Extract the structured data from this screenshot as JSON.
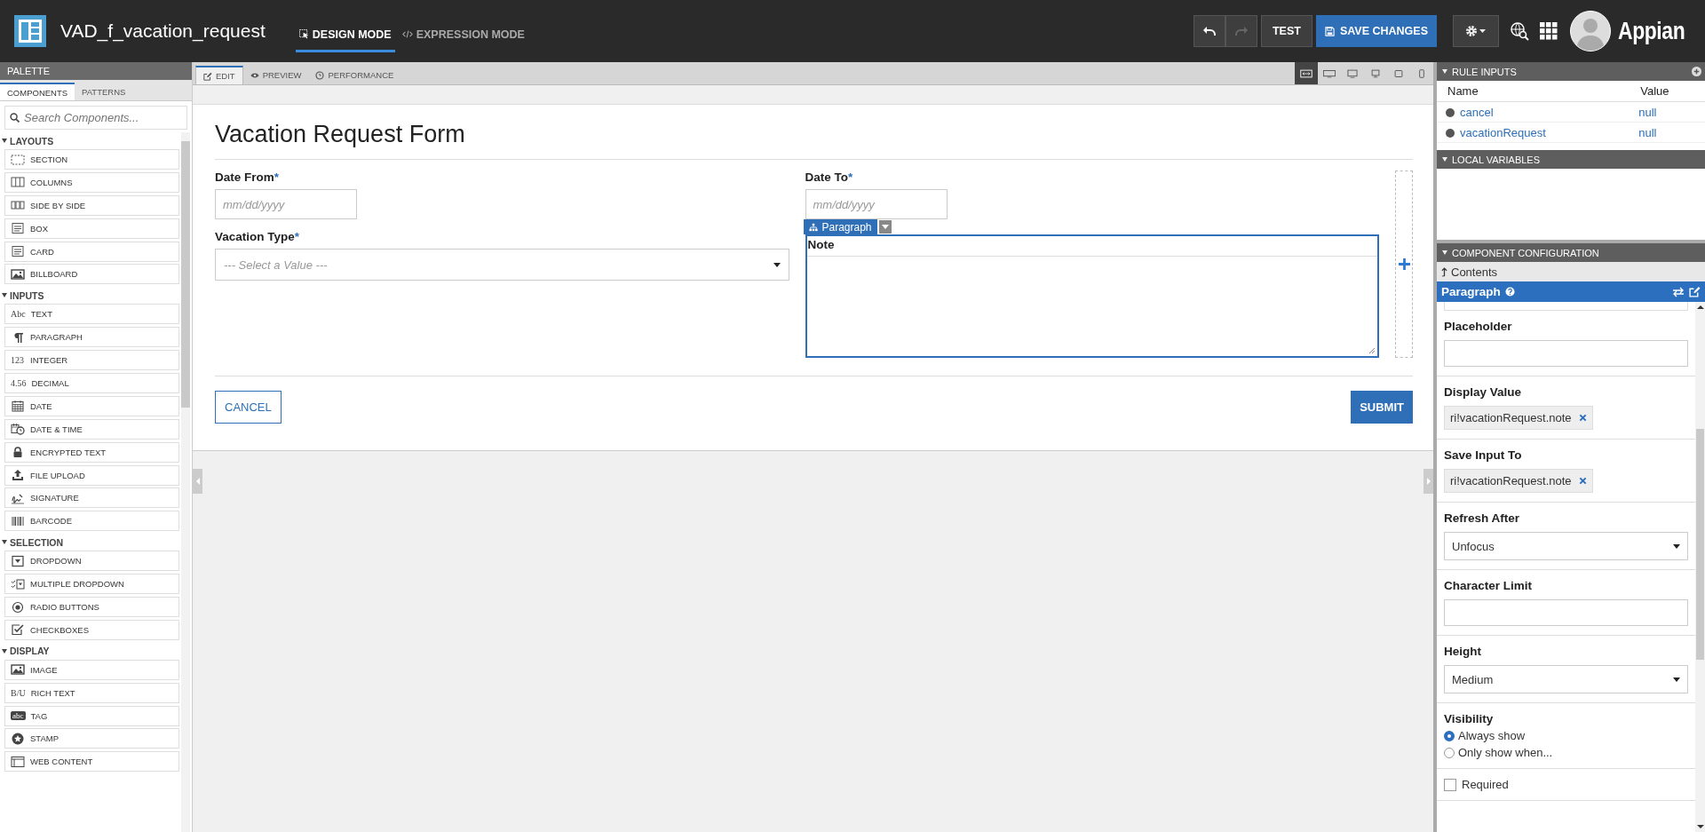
{
  "header": {
    "title": "VAD_f_vacation_request",
    "modes": [
      {
        "label": "DESIGN MODE",
        "selected": true
      },
      {
        "label": "EXPRESSION MODE",
        "selected": false
      }
    ],
    "undo": {
      "disabled": false
    },
    "redo": {
      "disabled": true
    },
    "test": "TEST",
    "save": "SAVE CHANGES",
    "brand": "Appian"
  },
  "palette": {
    "title": "PALETTE",
    "tabs": [
      {
        "label": "COMPONENTS",
        "selected": true
      },
      {
        "label": "PATTERNS",
        "selected": false
      }
    ],
    "search": {
      "placeholder": "Search Components..."
    },
    "groups": [
      {
        "label": "LAYOUTS",
        "expanded": true,
        "items": [
          {
            "label": "SECTION"
          },
          {
            "label": "COLUMNS"
          },
          {
            "label": "SIDE BY SIDE"
          },
          {
            "label": "BOX"
          },
          {
            "label": "CARD"
          },
          {
            "label": "BILLBOARD"
          }
        ]
      },
      {
        "label": "INPUTS",
        "expanded": true,
        "items": [
          {
            "label": "TEXT",
            "glyph": "Abc"
          },
          {
            "label": "PARAGRAPH"
          },
          {
            "label": "INTEGER",
            "glyph": "123"
          },
          {
            "label": "DECIMAL",
            "glyph": "4.56"
          },
          {
            "label": "DATE"
          },
          {
            "label": "DATE & TIME"
          },
          {
            "label": "ENCRYPTED TEXT"
          },
          {
            "label": "FILE UPLOAD"
          },
          {
            "label": "SIGNATURE"
          },
          {
            "label": "BARCODE"
          }
        ]
      },
      {
        "label": "SELECTION",
        "expanded": true,
        "items": [
          {
            "label": "DROPDOWN"
          },
          {
            "label": "MULTIPLE DROPDOWN"
          },
          {
            "label": "RADIO BUTTONS"
          },
          {
            "label": "CHECKBOXES"
          }
        ]
      },
      {
        "label": "DISPLAY",
        "expanded": true,
        "items": [
          {
            "label": "IMAGE"
          },
          {
            "label": "RICH TEXT",
            "glyph": "B/U"
          },
          {
            "label": "TAG",
            "glyph": "abc"
          },
          {
            "label": "STAMP"
          },
          {
            "label": "WEB CONTENT"
          }
        ]
      }
    ]
  },
  "editor": {
    "tabs": [
      {
        "label": "EDIT",
        "selected": true
      },
      {
        "label": "PREVIEW",
        "selected": false
      },
      {
        "label": "PERFORMANCE",
        "selected": false
      }
    ],
    "devices": [
      {
        "selected": true
      },
      {
        "selected": false
      },
      {
        "selected": false
      },
      {
        "selected": false
      },
      {
        "selected": false
      },
      {
        "selected": false
      }
    ],
    "form": {
      "title": "Vacation Request Form",
      "left": [
        {
          "kind": "date",
          "label": "Date From",
          "required_mark": "*",
          "placeholder": "mm/dd/yyyy"
        },
        {
          "kind": "select",
          "label": "Vacation Type",
          "required_mark": "*",
          "placeholder": "--- Select a Value ---"
        }
      ],
      "right": [
        {
          "kind": "date",
          "label": "Date To",
          "required_mark": "*",
          "placeholder": "mm/dd/yyyy"
        },
        {
          "kind": "paragraph",
          "label": "Note",
          "selected": true,
          "tag": "Paragraph"
        }
      ],
      "cancel": "CANCEL",
      "submit": "SUBMIT"
    }
  },
  "rule_inputs": {
    "title": "RULE INPUTS",
    "columns": [
      "Name",
      "Value"
    ],
    "rows": [
      {
        "name": "cancel",
        "value": "null"
      },
      {
        "name": "vacationRequest",
        "value": "null"
      }
    ]
  },
  "local_variables": {
    "title": "LOCAL VARIABLES",
    "expanded": true
  },
  "configuration": {
    "title": "COMPONENT CONFIGURATION",
    "contents": "Contents",
    "component": "Paragraph",
    "fields": [
      {
        "kind": "text",
        "label": "Placeholder"
      },
      {
        "kind": "chip",
        "label": "Display Value",
        "value": "ri!vacationRequest.note"
      },
      {
        "kind": "chip",
        "label": "Save Input To",
        "value": "ri!vacationRequest.note"
      },
      {
        "kind": "select",
        "label": "Refresh After",
        "value": "Unfocus"
      },
      {
        "kind": "text",
        "label": "Character Limit"
      },
      {
        "kind": "select",
        "label": "Height",
        "value": "Medium"
      },
      {
        "kind": "radio",
        "label": "Visibility",
        "options": [
          {
            "label": "Always show",
            "selected": true
          },
          {
            "label": "Only show when...",
            "selected": false
          }
        ]
      },
      {
        "kind": "checkbox",
        "label": "Required",
        "checked": false
      }
    ]
  }
}
